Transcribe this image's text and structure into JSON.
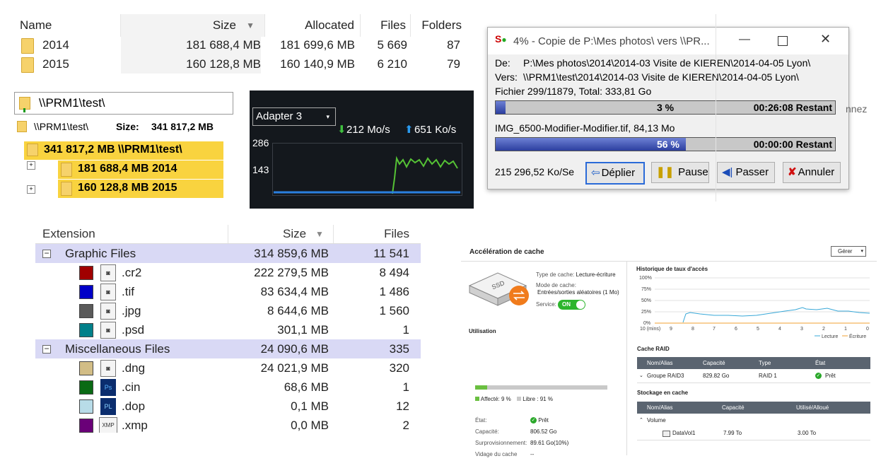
{
  "folder_table": {
    "headers": {
      "name": "Name",
      "size": "Size",
      "allocated": "Allocated",
      "files": "Files",
      "folders": "Folders"
    },
    "rows": [
      {
        "name": "2014",
        "size": "181 688,4 MB",
        "allocated": "181 699,6 MB",
        "files": "5 669",
        "folders": "87"
      },
      {
        "name": "2015",
        "size": "160 128,8 MB",
        "allocated": "160 140,9 MB",
        "files": "6 210",
        "folders": "79"
      }
    ]
  },
  "tree_panel": {
    "path": "\\\\PRM1\\test\\",
    "toolbar_path": "\\\\PRM1\\test\\",
    "size_label": "Size:",
    "size_value": "341 817,2 MB",
    "root": "341 817,2 MB  \\\\PRM1\\test\\",
    "children": [
      "181 688,4 MB  2014",
      "160 128,8 MB  2015"
    ],
    "expander": "+"
  },
  "network_panel": {
    "adapter": "Adapter 3",
    "download": "212 Mo/s",
    "upload": "651 Ko/s",
    "y_max": "286",
    "y_mid": "143"
  },
  "copy_dialog": {
    "title": "4% - Copie de P:\\Mes photos\\ vers \\\\PR...",
    "de_label": "De:",
    "de_value": "P:\\Mes photos\\2014\\2014-03 Visite de KIEREN\\2014-04-05 Lyon\\",
    "vers_label": "Vers:",
    "vers_value": "\\\\PRM1\\test\\2014\\2014-03 Visite de KIEREN\\2014-04-05 Lyon\\",
    "file_info": "Fichier 299/11879, Total: 333,81 Go",
    "total_progress": {
      "percent_label": "3 %",
      "fraction": 0.03,
      "remaining": "00:26:08 Restant"
    },
    "current_file": "IMG_6500-Modifier-Modifier.tif, 84,13 Mo",
    "file_progress": {
      "percent_label": "56 %",
      "fraction": 0.56,
      "remaining": "00:00:00 Restant"
    },
    "speed": "215 296,52 Ko/Se",
    "buttons": {
      "expand": "Déplier",
      "pause": "Pause",
      "skip": "Passer",
      "cancel": "Annuler"
    },
    "peek_text": "nnez"
  },
  "extension_table": {
    "headers": {
      "extension": "Extension",
      "size": "Size",
      "files": "Files"
    },
    "groups": [
      {
        "name": "Graphic Files",
        "size": "314 859,6 MB",
        "files": "11 541",
        "items": [
          {
            "ext": ".cr2",
            "size": "222 279,5 MB",
            "files": "8 494",
            "color": "#a00000"
          },
          {
            "ext": ".tif",
            "size": "83 634,4 MB",
            "files": "1 486",
            "color": "#0000c8"
          },
          {
            "ext": ".jpg",
            "size": "8 644,6 MB",
            "files": "1 560",
            "color": "#5a5a5a"
          },
          {
            "ext": ".psd",
            "size": "301,1 MB",
            "files": "1",
            "color": "#00808a"
          }
        ]
      },
      {
        "name": "Miscellaneous Files",
        "size": "24 090,6 MB",
        "files": "335",
        "items": [
          {
            "ext": ".dng",
            "size": "24 021,9 MB",
            "files": "320",
            "color": "#d2bd86"
          },
          {
            "ext": ".cin",
            "size": "68,6 MB",
            "files": "1",
            "color": "#0a6a14"
          },
          {
            "ext": ".dop",
            "size": "0,1 MB",
            "files": "12",
            "color": "#b8dce8"
          },
          {
            "ext": ".xmp",
            "size": "0,0 MB",
            "files": "2",
            "color": "#6a0078"
          }
        ]
      }
    ],
    "icon_labels": {
      "ps": "Ps",
      "pl": "PL",
      "xmp": "XMP"
    }
  },
  "cache_panel": {
    "title": "Accélération de cache",
    "manage": "Gérer",
    "ssd_label": "SSD",
    "cache_type_label": "Type de cache:",
    "cache_type_value": "Lecture-écriture",
    "cache_mode_label": "Mode de cache:",
    "cache_mode_value": "Entrées/sorties aléatoires (1 Mo)",
    "service_label": "Service:",
    "service_value": "ON",
    "usage_title": "Utilisation",
    "usage_fraction": 0.09,
    "allocated_label": "Affecté: 9 %",
    "free_label": "Libre : 91 %",
    "status_label": "État:",
    "status_value": "Prêt",
    "capacity_label": "Capacité:",
    "capacity_value": "806.52 Go",
    "overprov_label": "Surprovisionnement:",
    "overprov_value": "89.61 Go(10%)",
    "flush_label": "Vidage du cache",
    "flush_value": "--",
    "history_title": "Historique de taux d'accès",
    "y_ticks": [
      "100%",
      "75%",
      "50%",
      "25%",
      "0%"
    ],
    "x_ticks": [
      "10 (mins)",
      "9",
      "8",
      "7",
      "6",
      "5",
      "4",
      "3",
      "2",
      "1",
      "0"
    ],
    "legend": {
      "read": "Lecture",
      "write": "Écriture"
    },
    "raid_title": "Cache RAID",
    "raid_headers": [
      "Nom/Alias",
      "Capacité",
      "Type",
      "État"
    ],
    "raid_row": {
      "name": "Groupe RAID3",
      "capacity": "829.82 Go",
      "type": "RAID 1",
      "state": "Prêt"
    },
    "storage_title": "Stockage en cache",
    "storage_headers": [
      "Nom/Alias",
      "Capacité",
      "Utilisé/Alloué"
    ],
    "storage_group": "Volume",
    "storage_row": {
      "name": "DataVol1",
      "capacity": "7.99 To",
      "used": "3.00 To"
    },
    "colors": {
      "read": "#38a8d8",
      "write": "#f0a030",
      "ok": "#2aa82a",
      "toggle": "#2db52d"
    }
  }
}
